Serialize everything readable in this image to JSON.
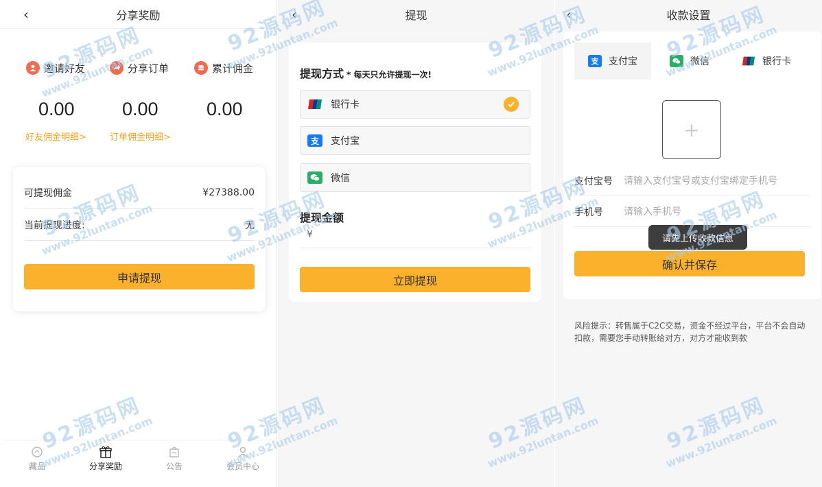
{
  "share_panel": {
    "title": "分享奖励",
    "back_icon": "‹",
    "stats": [
      {
        "label": "邀请好友",
        "value": "0.00",
        "link": "好友佣金明细>",
        "icon": "users-icon",
        "color": "#f06b52"
      },
      {
        "label": "分享订单",
        "value": "0.00",
        "link": "订单佣金明细>",
        "icon": "share-icon",
        "color": "#f06b52"
      },
      {
        "label": "累计佣金",
        "value": "0.00",
        "link": "",
        "icon": "coins-icon",
        "color": "#f06b52"
      }
    ],
    "withdrawable_label": "可提现佣金",
    "withdrawable_value": "¥27388.00",
    "progress_label": "当前提现进度:",
    "progress_value": "无",
    "apply_button": "申请提现",
    "tabs": [
      {
        "label": "藏品",
        "icon": "collection-icon",
        "active": false
      },
      {
        "label": "分享奖励",
        "icon": "gift-icon",
        "active": true
      },
      {
        "label": "公告",
        "icon": "notice-icon",
        "active": false
      },
      {
        "label": "会员中心",
        "icon": "user-icon",
        "active": false
      }
    ]
  },
  "withdraw_panel": {
    "title": "提现",
    "method_title": "提现方式",
    "method_note": "* 每天只允许提现一次!",
    "methods": [
      {
        "label": "银行卡",
        "icon": "unionpay-icon",
        "selected": true
      },
      {
        "label": "支付宝",
        "icon": "alipay-icon",
        "selected": false
      },
      {
        "label": "微信",
        "icon": "wechat-icon",
        "selected": false
      }
    ],
    "amount_title": "提现金额",
    "amount_prefix": "¥",
    "submit_button": "立即提现"
  },
  "payee_panel": {
    "title": "收款设置",
    "tabs": [
      {
        "label": "支付宝",
        "icon": "alipay-icon",
        "active": true
      },
      {
        "label": "微信",
        "icon": "wechat-icon",
        "active": false
      },
      {
        "label": "银行卡",
        "icon": "unionpay-icon",
        "active": false
      }
    ],
    "upload_plus": "+",
    "account_label": "支付宝号",
    "account_placeholder": "请输入支付宝号或支付宝绑定手机号",
    "phone_label": "手机号",
    "phone_placeholder": "请输入手机号",
    "toast": "请先上传收款信息",
    "save_button": "确认并保存",
    "risk_notice": "风险提示：转售属于C2C交易，资金不经过平台，平台不会自动扣款，需要您手动转账给对方，对方才能收到款"
  },
  "watermark": {
    "cn": "92源码网",
    "en": "www.92luntan.com"
  },
  "colors": {
    "accent": "#fbb12b",
    "link": "#f5a623",
    "alipay": "#1677ff",
    "wechat": "#2aae67",
    "unionpay": "#d7261e"
  }
}
